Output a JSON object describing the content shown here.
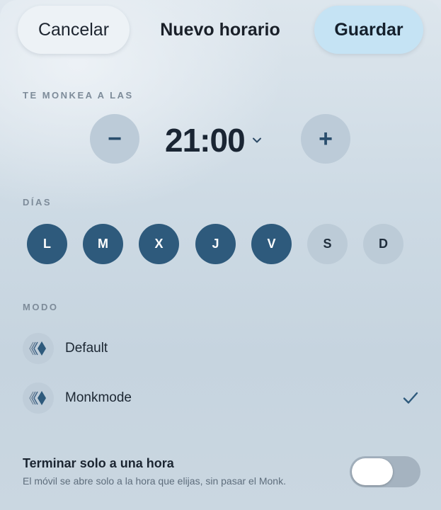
{
  "header": {
    "cancel_label": "Cancelar",
    "title": "Nuevo horario",
    "save_label": "Guardar"
  },
  "time_section": {
    "label": "TE MONKEA A LAS",
    "minus": "−",
    "value": "21:00",
    "plus": "+"
  },
  "days_section": {
    "label": "DÍAS",
    "days": [
      {
        "letter": "L",
        "selected": true
      },
      {
        "letter": "M",
        "selected": true
      },
      {
        "letter": "X",
        "selected": true
      },
      {
        "letter": "J",
        "selected": true
      },
      {
        "letter": "V",
        "selected": true
      },
      {
        "letter": "S",
        "selected": false
      },
      {
        "letter": "D",
        "selected": false
      }
    ]
  },
  "mode_section": {
    "label": "MODO",
    "modes": [
      {
        "label": "Default",
        "icon": "monk-logo-icon",
        "selected": false
      },
      {
        "label": "Monkmode",
        "icon": "monk-logo-icon",
        "selected": true
      }
    ]
  },
  "end_toggle": {
    "title": "Terminar solo a una hora",
    "subtitle": "El móvil se abre solo a la hora que elijas, sin pasar el Monk.",
    "on": false
  },
  "colors": {
    "accent": "#2e5a7c",
    "day_off": "#bccbd7",
    "save_bg": "#c5e3f4"
  }
}
